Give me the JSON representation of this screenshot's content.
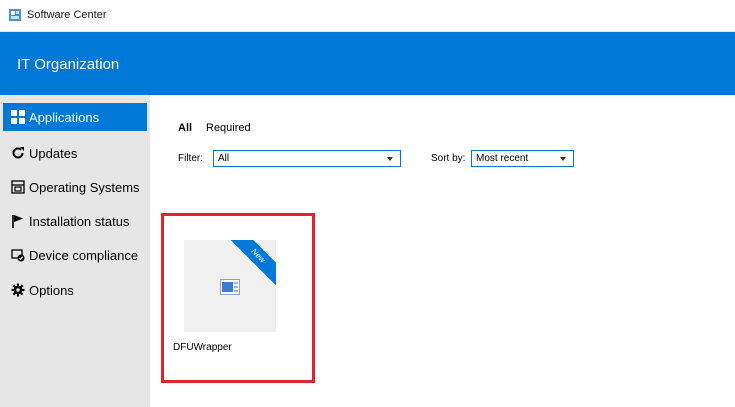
{
  "window": {
    "title": "Software Center"
  },
  "header": {
    "organization": "IT Organization"
  },
  "sidebar": {
    "items": [
      {
        "label": "Applications",
        "icon": "applications-icon",
        "active": true
      },
      {
        "label": "Updates",
        "icon": "refresh-icon",
        "active": false
      },
      {
        "label": "Operating Systems",
        "icon": "windows-stack-icon",
        "active": false
      },
      {
        "label": "Installation status",
        "icon": "flag-icon",
        "active": false
      },
      {
        "label": "Device compliance",
        "icon": "device-compliance-icon",
        "active": false
      },
      {
        "label": "Options",
        "icon": "gear-icon",
        "active": false
      }
    ]
  },
  "tabs": [
    {
      "label": "All",
      "selected": true
    },
    {
      "label": "Required",
      "selected": false
    }
  ],
  "filter": {
    "label": "Filter:",
    "value": "All"
  },
  "sort": {
    "label": "Sort by:",
    "value": "Most recent"
  },
  "apps": [
    {
      "name": "DFUWrapper",
      "badge": "New"
    }
  ],
  "colors": {
    "accent": "#0078d7",
    "sidebar_bg": "#e6e6e6",
    "highlight_border": "#e0232e",
    "tile_bg": "#f0f0f0"
  }
}
